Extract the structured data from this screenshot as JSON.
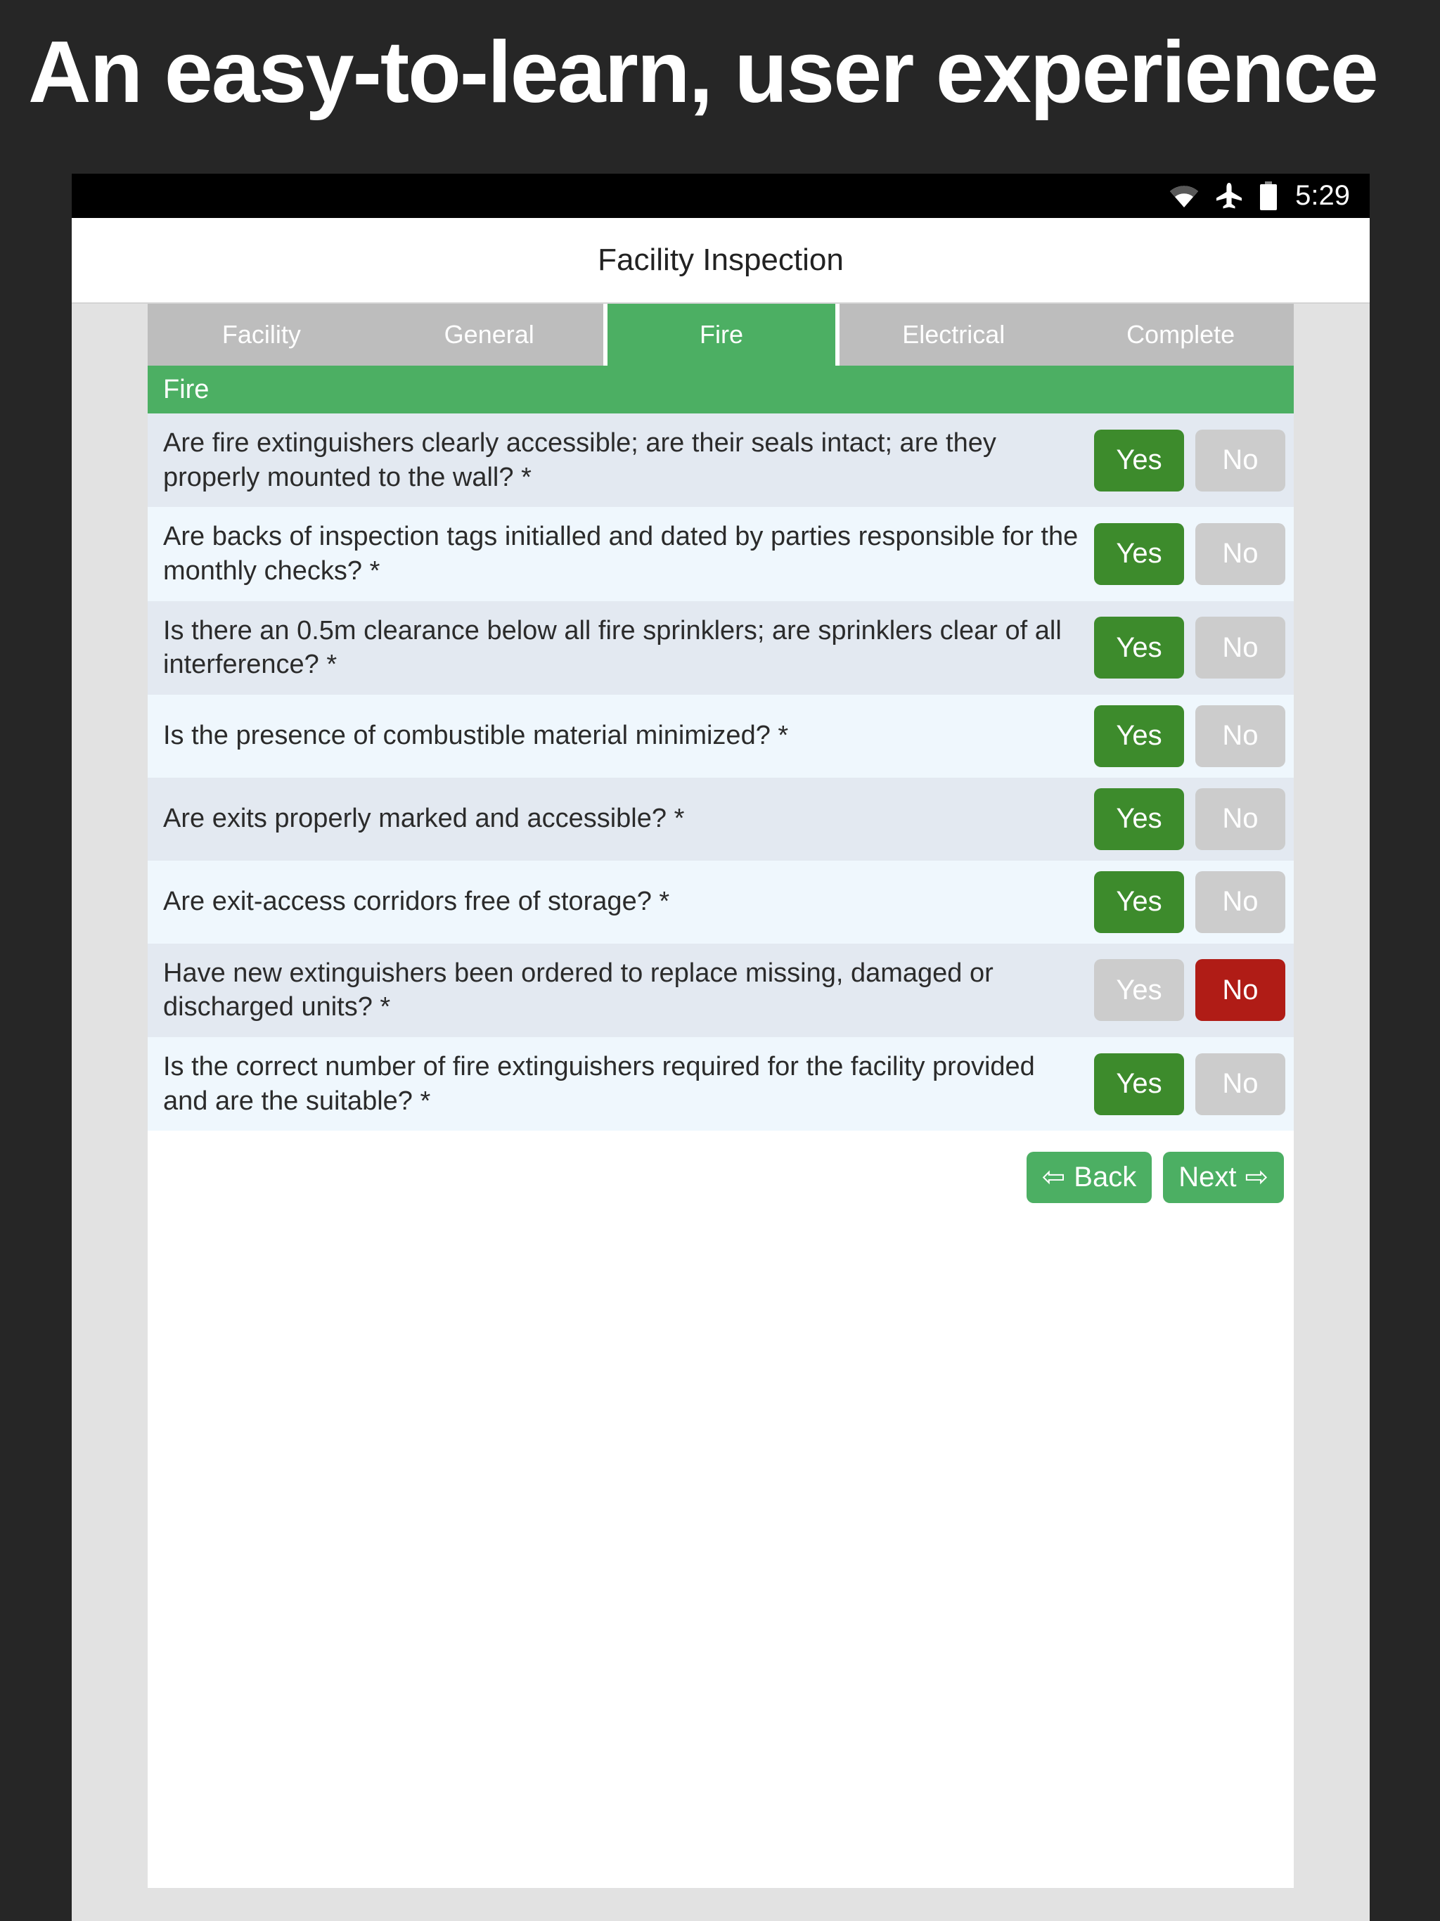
{
  "headline": "An easy-to-learn, user experience",
  "status_bar": {
    "icons": [
      "wifi-icon",
      "airplane-mode-icon",
      "battery-icon"
    ],
    "time": "5:29"
  },
  "app_bar": {
    "title": "Facility Inspection"
  },
  "tabs": [
    {
      "label": "Facility",
      "active": false
    },
    {
      "label": "General",
      "active": false
    },
    {
      "label": "Fire",
      "active": true
    },
    {
      "label": "Electrical",
      "active": false
    },
    {
      "label": "Complete",
      "active": false
    }
  ],
  "section": {
    "title": "Fire"
  },
  "answer_labels": {
    "yes": "Yes",
    "no": "No"
  },
  "questions": [
    {
      "text": "Are fire extinguishers clearly accessible; are their seals intact; are they properly mounted to the wall? *",
      "answer": "Yes"
    },
    {
      "text": "Are backs of inspection tags initialled and dated by parties responsible for the monthly checks? *",
      "answer": "Yes"
    },
    {
      "text": "Is there an 0.5m clearance below all fire sprinklers; are sprinklers clear of all interference? *",
      "answer": "Yes"
    },
    {
      "text": "Is the presence of combustible material minimized? *",
      "answer": "Yes"
    },
    {
      "text": "Are exits properly marked and accessible? *",
      "answer": "Yes"
    },
    {
      "text": "Are exit-access corridors free of storage? *",
      "answer": "Yes"
    },
    {
      "text": "Have new extinguishers been ordered to replace missing, damaged or discharged units? *",
      "answer": "No"
    },
    {
      "text": "Is the correct number of fire extinguishers required for the facility provided and are the suitable? *",
      "answer": "Yes"
    }
  ],
  "nav": {
    "back_label": "Back",
    "back_icon": "arrow-left-icon",
    "back_glyph": "⇦",
    "next_label": "Next",
    "next_icon": "arrow-right-icon",
    "next_glyph": "⇨"
  },
  "colors": {
    "accent_green": "#4caf63",
    "selected_green": "#3d8b2c",
    "selected_red": "#b01c16",
    "unselected_gray": "#cccccc",
    "tab_inactive": "#bdbdbd",
    "row_odd": "#e3e9f1",
    "row_even": "#eff7fd",
    "page_background": "#262626"
  }
}
